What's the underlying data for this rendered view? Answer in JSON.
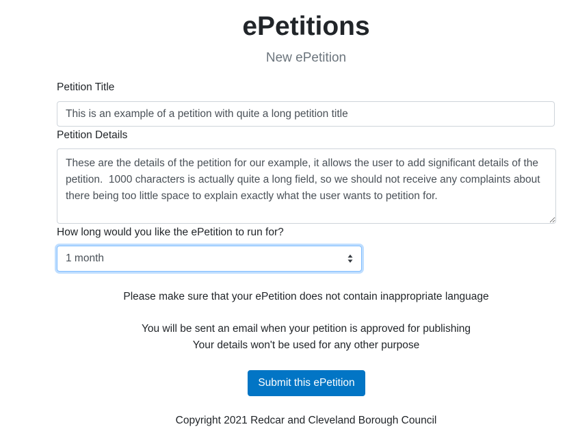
{
  "header": {
    "title": "ePetitions",
    "subtitle": "New ePetition"
  },
  "form": {
    "title_label": "Petition Title",
    "title_value": "This is an example of a petition with quite a long petition title",
    "details_label": "Petition Details",
    "details_value": "These are the details of the petition for our example, it allows the user to add significant details of the petition.  1000 characters is actually quite a long field, so we should not receive any complaints about there being too little space to explain exactly what the user wants to petition for.",
    "duration_label": "How long would you like the ePetition to run for?",
    "duration_value": "1 month",
    "duration_icon": "select-arrows-icon"
  },
  "notices": {
    "language_notice": "Please make sure that your ePetition does not contain inappropriate language",
    "email_notice": "You will be sent an email when your petition is approved for publishing",
    "privacy_notice": "Your details won't be used for any other purpose"
  },
  "actions": {
    "submit_label": "Submit this ePetition"
  },
  "footer": {
    "copyright": "Copyright 2021 Redcar and Cleveland Borough Council"
  },
  "colors": {
    "primary_button": "#0275c5",
    "focus_border": "#80bdff",
    "muted_text": "#6c757d"
  }
}
